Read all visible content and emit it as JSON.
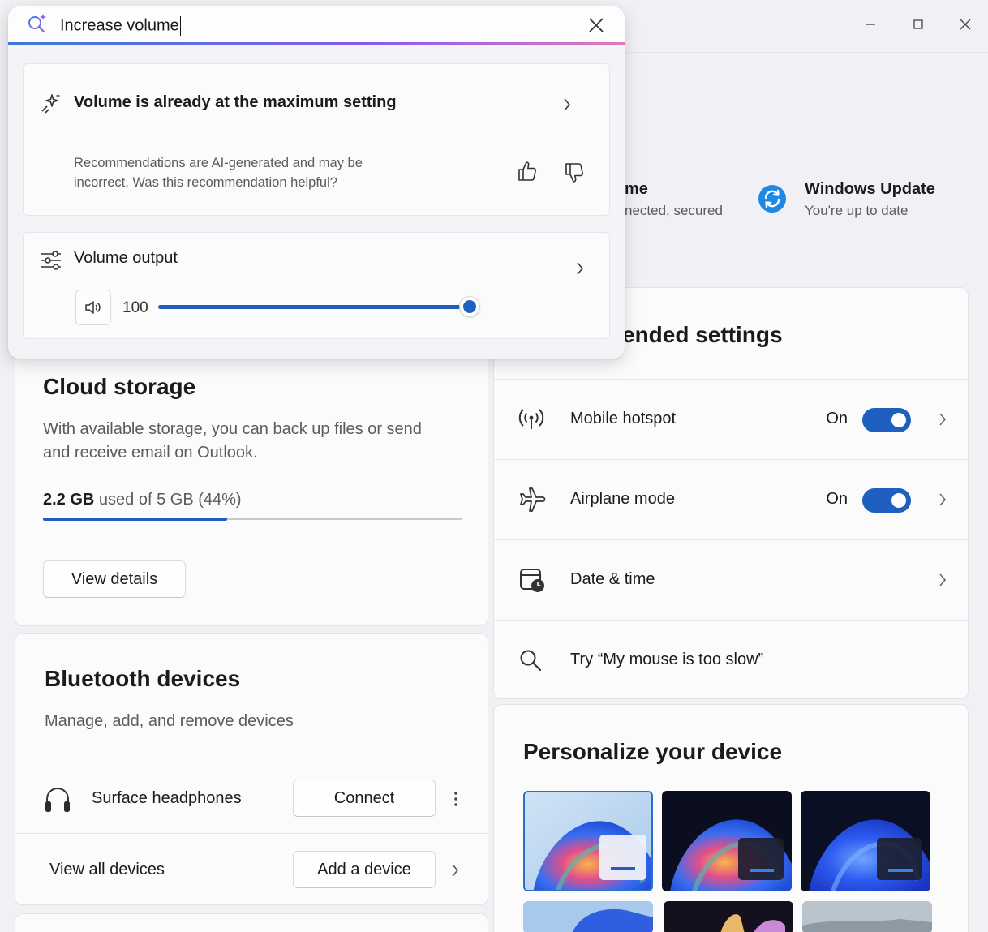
{
  "window": {
    "minimize_icon": "minimize-icon",
    "maximize_icon": "maximize-icon",
    "close_icon": "close-icon"
  },
  "status": {
    "network_title_partial": "me",
    "network_sub_partial": "nected, secured",
    "update_title": "Windows Update",
    "update_sub": "You're up to date"
  },
  "cloud": {
    "title": "Cloud storage",
    "desc": "With available storage, you can back up files or send and receive email on Outlook.",
    "used": "2.2 GB",
    "used_rest": "used of 5 GB (44%)",
    "progress": 0.44,
    "button": "View details"
  },
  "bluetooth": {
    "title": "Bluetooth devices",
    "desc": "Manage, add, and remove devices",
    "device_name": "Surface headphones",
    "connect_label": "Connect",
    "view_all": "View all devices",
    "add_label": "Add a device"
  },
  "recommended": {
    "title_partial": "ended settings",
    "rows": [
      {
        "label": "Mobile hotspot",
        "state": "On",
        "icon": "hotspot-icon"
      },
      {
        "label": "Airplane mode",
        "state": "On",
        "icon": "airplane-icon"
      },
      {
        "label": "Date & time",
        "icon": "calendar-clock-icon"
      },
      {
        "label": "Try “My mouse is too slow”",
        "icon": "search-icon"
      }
    ]
  },
  "personalize": {
    "title": "Personalize your device"
  },
  "search": {
    "query": "Increase volume",
    "ai_result": "Volume is already at the maximum setting",
    "disclaimer": "Recommendations are AI-generated and may be incorrect. Was this recommendation helpful?",
    "volume_label": "Volume output",
    "volume_value": "100",
    "volume_level": 1.0
  },
  "colors": {
    "accent": "#1f5fbf",
    "update_blue": "#1e88e5"
  }
}
